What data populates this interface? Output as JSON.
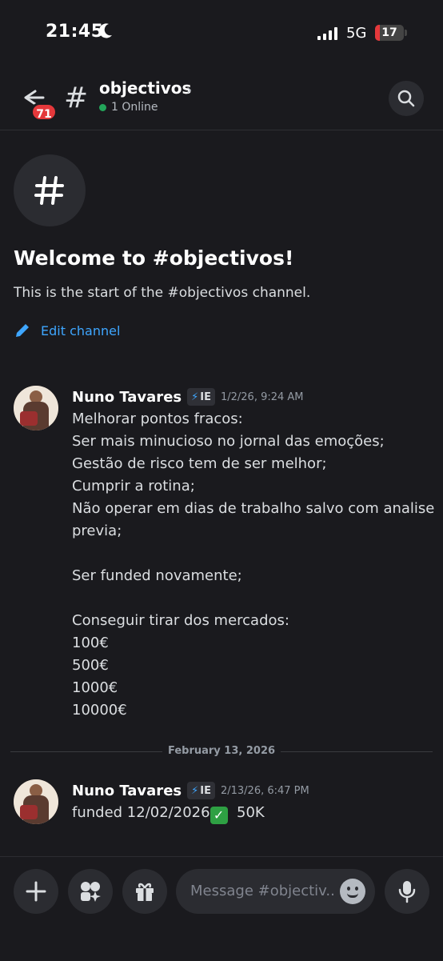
{
  "status_bar": {
    "time": "21:45",
    "network": "5G",
    "battery": "17",
    "battery_level": 0.17
  },
  "header": {
    "unread_count": "71",
    "channel_name": "objectivos",
    "online_text": "1 Online"
  },
  "welcome": {
    "title": "Welcome to #objectivos!",
    "subtitle": "This is the start of the #objectivos channel.",
    "edit_label": "Edit channel"
  },
  "messages": [
    {
      "author": "Nuno Tavares",
      "tag": "IE",
      "timestamp": "1/2/26, 9:24 AM",
      "lines": [
        "Melhorar pontos fracos:",
        "Ser mais minucioso no jornal das emoções;",
        "Gestão de risco tem de ser melhor;",
        "Cumprir a rotina;",
        "Não operar em dias de trabalho salvo com analise",
        "previa;",
        "",
        "Ser funded novamente;",
        "",
        "Conseguir tirar dos mercados:",
        "100€",
        "500€",
        "1000€",
        "10000€"
      ]
    },
    {
      "author": "Nuno Tavares",
      "tag": "IE",
      "timestamp": "2/13/26, 6:47 PM",
      "text_before": "funded 12/02/2026",
      "text_after": "  50K"
    }
  ],
  "date_divider": "February 13, 2026",
  "composer": {
    "placeholder": "Message #objectiv.."
  },
  "colors": {
    "background": "#1a1a1e",
    "accent": "#3ea6ff",
    "badge": "#e5383b",
    "online": "#23a55a"
  },
  "icons": [
    "back-arrow-icon",
    "hash-icon",
    "chevron-right-icon",
    "search-icon",
    "pencil-icon",
    "bolt-icon",
    "check-emoji-icon",
    "plus-icon",
    "apps-icon",
    "gift-icon",
    "emoji-icon",
    "microphone-icon",
    "moon-icon",
    "signal-icon",
    "battery-icon"
  ]
}
